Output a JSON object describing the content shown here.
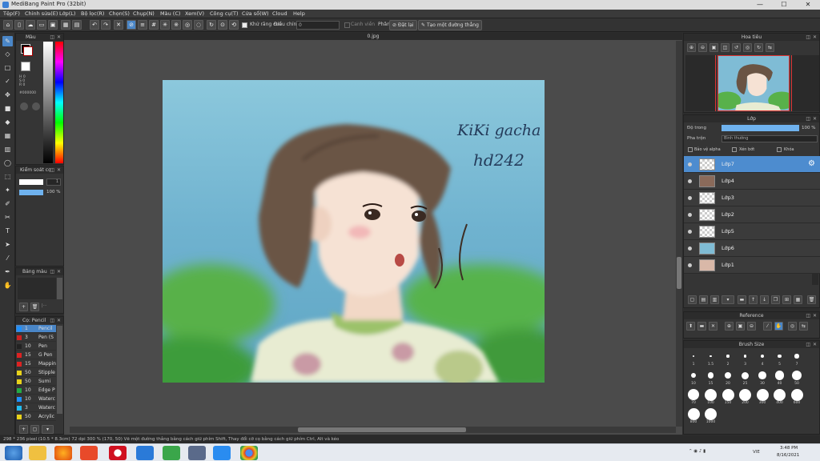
{
  "window": {
    "title": "MediBang Paint Pro (32bit)",
    "min": "—",
    "max": "☐",
    "close": "✕"
  },
  "menu": [
    "Tệp(F)",
    "Chỉnh sửa(E)",
    "Lớp(L)",
    "Bộ lọc(R)",
    "Chọn(S)",
    "Chụp(N)",
    "Màu (C)",
    "Xem(V)",
    "Công cụ(T)",
    "Cửa sổ(W)",
    "Cloud",
    "Help"
  ],
  "toolbar": {
    "antialias_label": "Khử răng cưa",
    "adjust_label": "Điều chỉnh",
    "adjust_value": "0",
    "edge_label": "Canh viền",
    "snap_label": "Phân",
    "snap_off_label": "Đặt lại",
    "ruler_label": "Tạo một đường thẳng"
  },
  "color_panel": {
    "title": "Màu",
    "h": "H 0",
    "s": "S 0",
    "v": "V 0",
    "r": "R 0",
    "hex": "#000000",
    "primary_color": "#000000",
    "secondary_color": "#ffffff"
  },
  "brush_control": {
    "title": "Kiểm soát cọ",
    "size": "1",
    "opacity": "100 %"
  },
  "palette": {
    "title": "Bảng màu"
  },
  "brush_panel": {
    "title": "Cọ: Pencil",
    "items": [
      {
        "size": "1",
        "name": "Pencil",
        "color": "#1e90ff"
      },
      {
        "size": "3",
        "name": "Pen (S",
        "color": "#cc2222"
      },
      {
        "size": "10",
        "name": "Pen",
        "color": "#222222"
      },
      {
        "size": "15",
        "name": "G Pen",
        "color": "#dd2222"
      },
      {
        "size": "15",
        "name": "Mapping",
        "color": "#dd2222"
      },
      {
        "size": "50",
        "name": "Stipple",
        "color": "#e8d21a"
      },
      {
        "size": "50",
        "name": "Sumi",
        "color": "#e8d21a"
      },
      {
        "size": "10",
        "name": "Edge P",
        "color": "#22aa44"
      },
      {
        "size": "10",
        "name": "Waterc",
        "color": "#1e90ff"
      },
      {
        "size": "3",
        "name": "Waterc",
        "color": "#22bbee"
      },
      {
        "size": "50",
        "name": "Acrylic",
        "color": "#e8d21a"
      }
    ]
  },
  "document": {
    "tab": "0.jpg"
  },
  "artwork": {
    "caption_line1": "KiKi gacha",
    "caption_line2": "hd242"
  },
  "navigator": {
    "title": "Hoa tiêu"
  },
  "layers_panel": {
    "title": "Lớp",
    "opacity_label": "Độ trong",
    "opacity_value": "100 %",
    "opacity_fraction": 1.0,
    "blend_label": "Pha trộn",
    "blend_value": "Bình thường",
    "protect_alpha": "Bảo vệ alpha",
    "clipping": "Xén bớt",
    "lock": "Khóa",
    "layers": [
      {
        "name": "Lớp7",
        "selected": true
      },
      {
        "name": "Lớp4",
        "selected": false
      },
      {
        "name": "Lớp3",
        "selected": false
      },
      {
        "name": "Lớp2",
        "selected": false
      },
      {
        "name": "Lớp5",
        "selected": false
      },
      {
        "name": "Lớp6",
        "selected": false
      },
      {
        "name": "Lớp1",
        "selected": false
      }
    ]
  },
  "reference": {
    "title": "Reference"
  },
  "brush_size": {
    "title": "Brush Size",
    "sizes": [
      "1",
      "1.5",
      "2",
      "3",
      "4",
      "5",
      "7",
      "10",
      "15",
      "20",
      "25",
      "30",
      "40",
      "50",
      "70",
      "100",
      "150",
      "200",
      "300",
      "400",
      "600",
      "800",
      "1000"
    ]
  },
  "status": {
    "text": "298 * 236 pixel   (10.5 * 8.3cm)   72 dpi   300 %   (170, 50)   Vẽ một đường thẳng bằng cách giữ phím Shift, Thay đổi cỡ cọ bằng cách giữ phím Ctrl, Alt và kéo"
  },
  "taskbar": {
    "time": "3:48 PM",
    "date": "8/16/2021",
    "lang": "VIE"
  }
}
